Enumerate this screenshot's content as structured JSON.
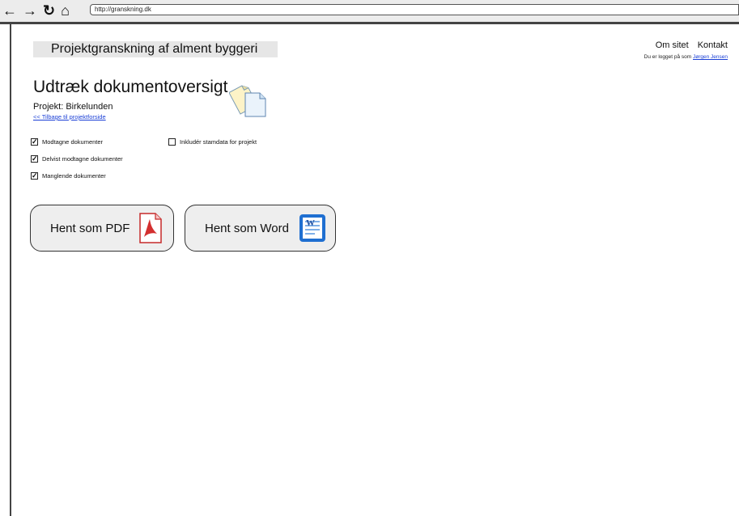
{
  "browser": {
    "url": "http://granskning.dk",
    "icons": [
      "arrow-left-icon",
      "arrow-right-icon",
      "reload-icon",
      "home-icon"
    ]
  },
  "header": {
    "site_title": "Projektgranskning af alment byggeri",
    "links": [
      {
        "label": "Om sitet"
      },
      {
        "label": "Kontakt"
      }
    ],
    "login_prefix": "Du er logget på som",
    "user_name": "Jørgen Jensen"
  },
  "page": {
    "title": "Udtræk dokumentoversigt",
    "project_label": "Projekt: Birkelunden",
    "back_link": "<< Tilbage til projektforside",
    "title_icon": "documents-icon"
  },
  "options": {
    "received": {
      "label": "Modtagne dokumenter",
      "checked": true
    },
    "partial": {
      "label": "Delvist modtagne dokumenter",
      "checked": true
    },
    "missing": {
      "label": "Manglende dokumenter",
      "checked": true
    },
    "masterdata": {
      "label": "Inkludér stamdata for projekt",
      "checked": false
    }
  },
  "actions": {
    "pdf": {
      "label": "Hent som PDF",
      "icon": "pdf-icon",
      "color": "#d32f2f"
    },
    "word": {
      "label": "Hent som Word",
      "icon": "word-icon",
      "color": "#1f6fd1"
    }
  }
}
